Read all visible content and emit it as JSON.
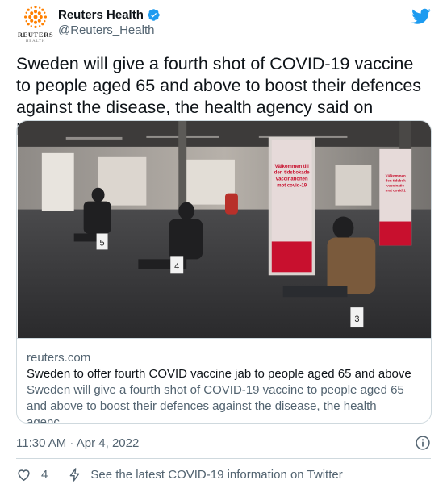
{
  "account": {
    "display_name": "Reuters Health",
    "handle": "@Reuters_Health",
    "avatar_wordmark": "REUTERS",
    "avatar_subtext": "HEALTH",
    "verified_icon": "verified-badge-icon"
  },
  "tweet": {
    "text": "Sweden will give a fourth shot of COVID-19 vaccine to people aged 65 and above to boost their defences against the disease, the health agency said on Monday."
  },
  "card": {
    "domain": "reuters.com",
    "title": "Sweden to offer fourth COVID vaccine jab to people aged 65 and above",
    "description": "Sweden will give a fourth shot of COVID-19 vaccine to people aged 65 and above to boost their defences against the disease, the health agenc…",
    "photo": {
      "banner_left": [
        "Välkommen till",
        "den tidsbokade",
        "vaccinationen",
        "mot covid-19"
      ],
      "banner_right": [
        "Välkommen",
        "den tidsbok",
        "vaccinatio",
        "mot covid-1"
      ],
      "chair_numbers": [
        "5",
        "4",
        "3"
      ]
    }
  },
  "meta": {
    "timestamp": "11:30 AM · Apr 4, 2022",
    "like_count": "4",
    "covid_link_text": "See the latest COVID-19 information on Twitter"
  },
  "colors": {
    "twitter_blue": "#1d9bf0",
    "reuters_orange": "#ff8000",
    "text_secondary": "#536471",
    "border": "#cfd9de"
  }
}
